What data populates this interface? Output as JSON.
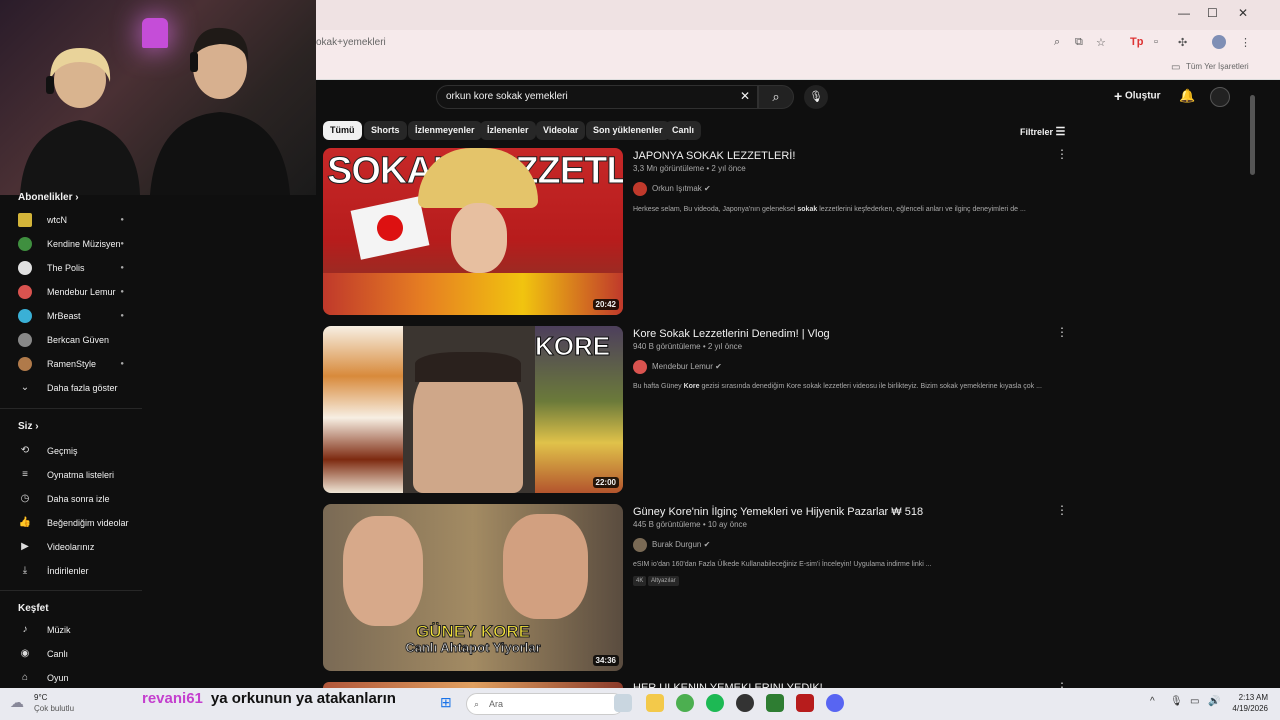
{
  "browser": {
    "url_text": "okak+yemekleri",
    "bookmarks_label": "Tüm Yer İşaretleri"
  },
  "header": {
    "search_value": "orkun kore sokak yemekleri",
    "create_label": "Oluştur"
  },
  "chips": [
    "Tümü",
    "Shorts",
    "İzlenmeyenler",
    "İzlenenler",
    "Videolar",
    "Son yüklenenler",
    "Canlı"
  ],
  "filters_label": "Filtreler",
  "sidebar": {
    "subscriptions_heading": "Abonelikler",
    "subscriptions": [
      {
        "label": "wtcN",
        "dot": true,
        "color": "#d4b53a"
      },
      {
        "label": "Kendine Müzisyen",
        "dot": true,
        "color": "#3f8f3f"
      },
      {
        "label": "The Polis",
        "dot": true,
        "color": "#e0e0e0"
      },
      {
        "label": "Mendebur Lemur",
        "dot": true,
        "color": "#d9534f"
      },
      {
        "label": "MrBeast",
        "dot": true,
        "color": "#3ab0d6"
      },
      {
        "label": "Berkcan Güven",
        "dot": false,
        "color": "#888888"
      },
      {
        "label": "RamenStyle",
        "dot": true,
        "color": "#b07a4a"
      }
    ],
    "show_more_label": "Daha fazla göster",
    "you_heading": "Siz",
    "you_items": [
      {
        "label": "Geçmiş",
        "icon": "history-icon"
      },
      {
        "label": "Oynatma listeleri",
        "icon": "playlist-icon"
      },
      {
        "label": "Daha sonra izle",
        "icon": "clock-icon"
      },
      {
        "label": "Beğendiğim videolar",
        "icon": "thumbs-up-icon"
      },
      {
        "label": "Videolarınız",
        "icon": "video-icon"
      },
      {
        "label": "İndirilenler",
        "icon": "download-icon"
      }
    ],
    "explore_heading": "Keşfet",
    "explore_items": [
      {
        "label": "Müzik",
        "icon": "music-icon"
      },
      {
        "label": "Canlı",
        "icon": "live-icon"
      },
      {
        "label": "Oyun",
        "icon": "game-icon"
      }
    ]
  },
  "videos": [
    {
      "title": "JAPONYA SOKAK LEZZETLERİ!",
      "meta": "3,3 Mn görüntüleme • 2 yıl önce",
      "channel": "Orkun Işıtmak",
      "verified": true,
      "description_before": "Herkese selam, Bu videoda, Japonya'nın geleneksel ",
      "description_bold": "sokak",
      "description_after": " lezzetlerini keşfederken, eğlenceli anları ve ilginç deneyimleri de ...",
      "duration": "20:42",
      "thumb_text": "SOKAK LEZZETLERİ",
      "avatar_color": "#c0392b"
    },
    {
      "title": "Kore Sokak Lezzetlerini Denedim! | Vlog",
      "meta": "940 B görüntüleme • 2 yıl önce",
      "channel": "Mendebur Lemur",
      "verified": true,
      "description_before": "Bu hafta Güney ",
      "description_bold": "Kore",
      "description_after": " gezisi sırasında denediğim Kore sokak lezzetleri videosu ile birlikteyiz. Bizim sokak yemeklerine kıyasla çok ...",
      "duration": "22:00",
      "thumb_text": "KORE",
      "avatar_color": "#d9534f"
    },
    {
      "title": "Güney Kore'nin İlginç Yemekleri ve Hijyenik Pazarlar ₩ 518",
      "meta": "445 B görüntüleme • 10 ay önce",
      "channel": "Burak Durgun",
      "verified": true,
      "description_before": "eSIM io'dan 160'dan Fazla Ülkede Kullanabileceğiniz E-sim'i İnceleyin! Uygulama indirme linki ...",
      "description_bold": "",
      "description_after": "",
      "duration": "34:36",
      "thumb_text_1": "GÜNEY KORE",
      "thumb_text_2": "Canlı Ahtapot Yiyorlar",
      "badges": [
        "4K",
        "Altyazılar"
      ],
      "avatar_color": "#7a6a55"
    },
    {
      "title": "HER ÜLKENİN YEMEKLERİNİ YEDİK!"
    }
  ],
  "taskbar": {
    "weather_temp": "9°C",
    "weather_desc": "Çok bulutlu",
    "search_placeholder": "Ara",
    "time": "2:13 AM",
    "date": "4/19/2026"
  },
  "overlay": {
    "subtitle_user": "revani61",
    "subtitle_text": "ya orkunun ya atakanların"
  }
}
